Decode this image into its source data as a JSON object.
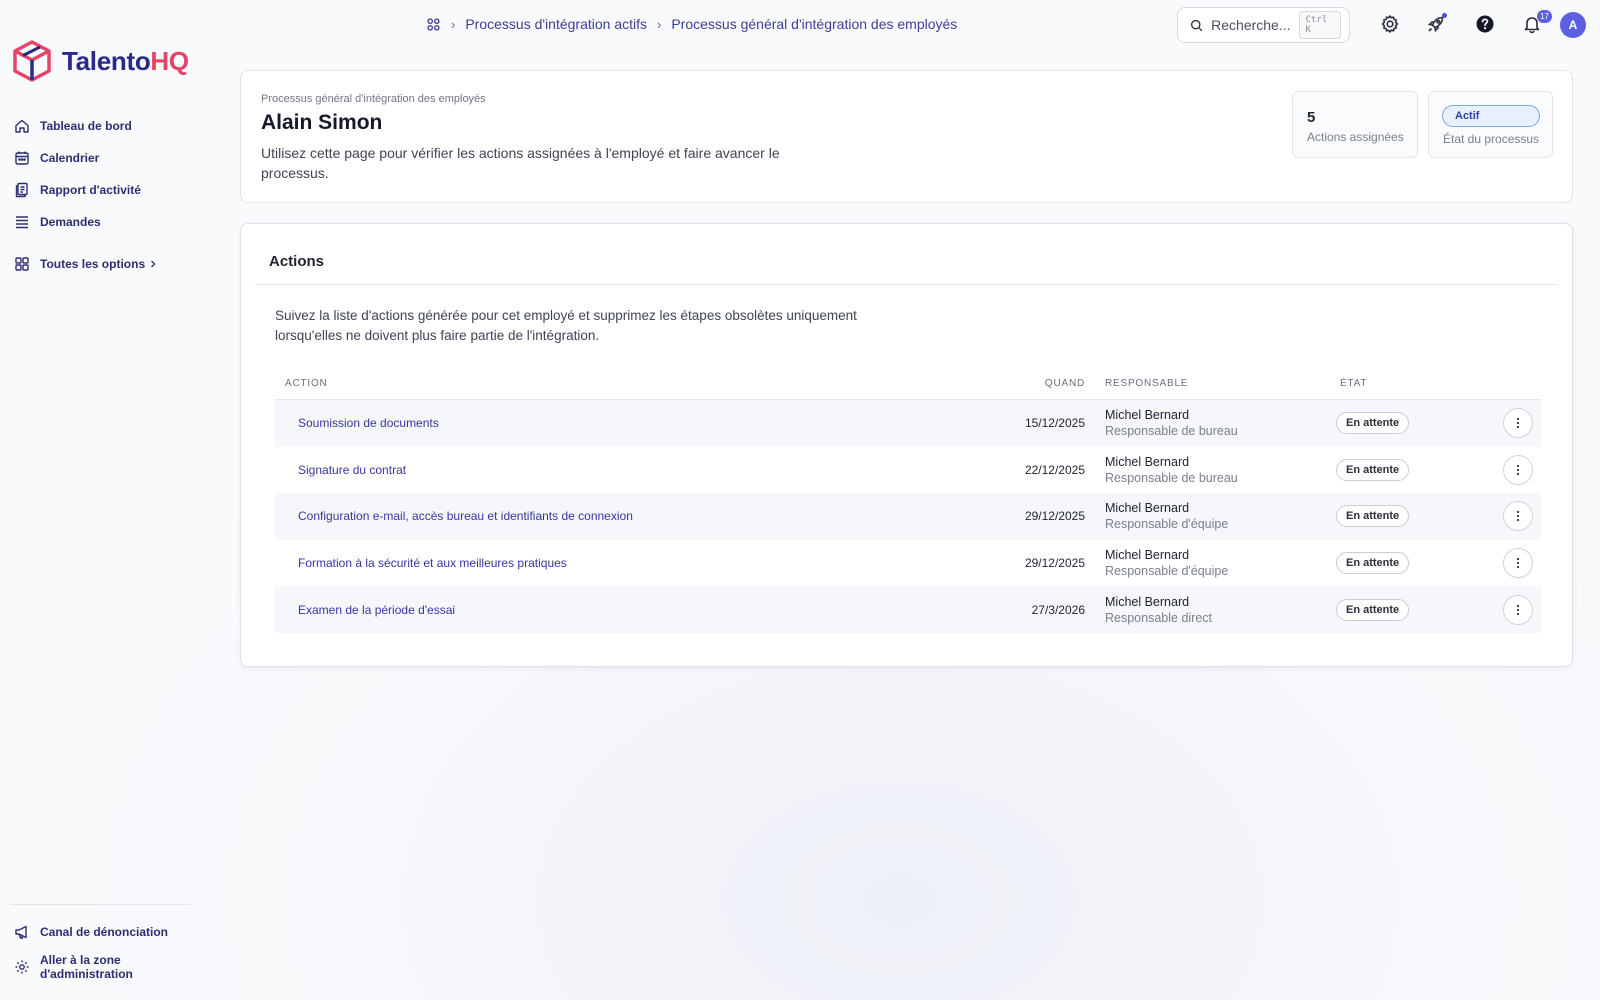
{
  "app": {
    "brand_part1": "Talento",
    "brand_part2": "HQ",
    "colors": {
      "primary": "#2a2a8c",
      "brand_pink": "#e4436a",
      "accent": "#5b5fe0"
    }
  },
  "sidebar": {
    "items": [
      {
        "label": "Tableau de bord",
        "icon": "home-icon"
      },
      {
        "label": "Calendrier",
        "icon": "calendar-icon"
      },
      {
        "label": "Rapport d'activité",
        "icon": "report-icon"
      },
      {
        "label": "Demandes",
        "icon": "list-icon"
      }
    ],
    "all_options": {
      "label": "Toutes les options",
      "icon": "grid-icon"
    },
    "bottom": [
      {
        "label": "Canal de dénonciation",
        "icon": "megaphone-icon"
      },
      {
        "label": "Aller à la zone d'administration",
        "line1": "Aller à la zone",
        "line2": "d'administration",
        "icon": "gear-icon"
      }
    ]
  },
  "topbar": {
    "breadcrumb": [
      "Processus d'intégration actifs",
      "Processus général d'intégration des employés"
    ],
    "search": {
      "placeholder": "Recherche...",
      "shortcut": "Ctrl K"
    },
    "notifications_count": "17",
    "avatar_initial": "A"
  },
  "header": {
    "subtitle": "Processus général d'intégration des employés",
    "title": "Alain Simon",
    "description": "Utilisez cette page pour vérifier les actions assignées à l'employé et faire avancer le processus.",
    "stats": {
      "assigned_count": "5",
      "assigned_label": "Actions assignées",
      "state_value": "Actif",
      "state_label": "État du processus"
    }
  },
  "actions": {
    "title": "Actions",
    "description": "Suivez la liste d'actions générée pour cet employé et supprimez les étapes obsolètes uniquement lorsqu'elles ne doivent plus faire partie de l'intégration.",
    "columns": {
      "action": "ACTION",
      "when": "QUAND",
      "responsible": "RESPONSABLE",
      "state": "ÉTAT"
    },
    "rows": [
      {
        "action": "Soumission de documents",
        "when": "15/12/2025",
        "name": "Michel Bernard",
        "role": "Responsable de bureau",
        "state": "En attente"
      },
      {
        "action": "Signature du contrat",
        "when": "22/12/2025",
        "name": "Michel Bernard",
        "role": "Responsable de bureau",
        "state": "En attente"
      },
      {
        "action": "Configuration e-mail, accès bureau et identifiants de connexion",
        "when": "29/12/2025",
        "name": "Michel Bernard",
        "role": "Responsable d'équipe",
        "state": "En attente"
      },
      {
        "action": "Formation à la sécurité et aux meilleures pratiques",
        "when": "29/12/2025",
        "name": "Michel Bernard",
        "role": "Responsable d'équipe",
        "state": "En attente"
      },
      {
        "action": "Examen de la période d'essai",
        "when": "27/3/2026",
        "name": "Michel Bernard",
        "role": "Responsable direct",
        "state": "En attente"
      }
    ]
  }
}
